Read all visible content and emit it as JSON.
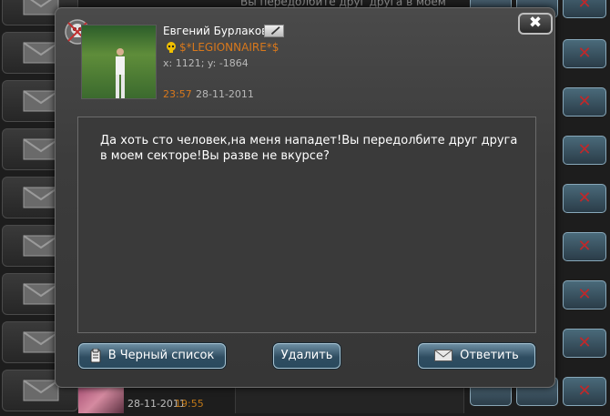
{
  "background": {
    "top_message_preview": "Вы передолбите друг друга в моем",
    "last_row": {
      "date": "28-11-2011",
      "time": "19:55"
    },
    "row_close_glyph": "✕",
    "row_count": 9
  },
  "dialog": {
    "close_glyph": "✖",
    "sender": {
      "name": "Евгений Бурлаков",
      "clan": "$*LEGIONNAIRE*$",
      "coords": "x: 1121; y: -1864",
      "time": "23:57",
      "date": "28-11-2011"
    },
    "message": "Да хоть сто человек,на меня нападет!Вы передолбите друг друга в моем секторе!Вы разве не вкурсе?",
    "buttons": {
      "blacklist": "В Черный список",
      "delete": "Удалить",
      "reply": "Ответить"
    }
  },
  "colors": {
    "accent_orange": "#d8781c",
    "button_blue": "#2f4d61",
    "close_red": "#c0282a"
  },
  "icons": [
    "envelope-icon",
    "close-icon",
    "skull-rank-icon",
    "edit-pencil-icon",
    "clan-skull-icon",
    "clipboard-icon",
    "trash-icon"
  ]
}
